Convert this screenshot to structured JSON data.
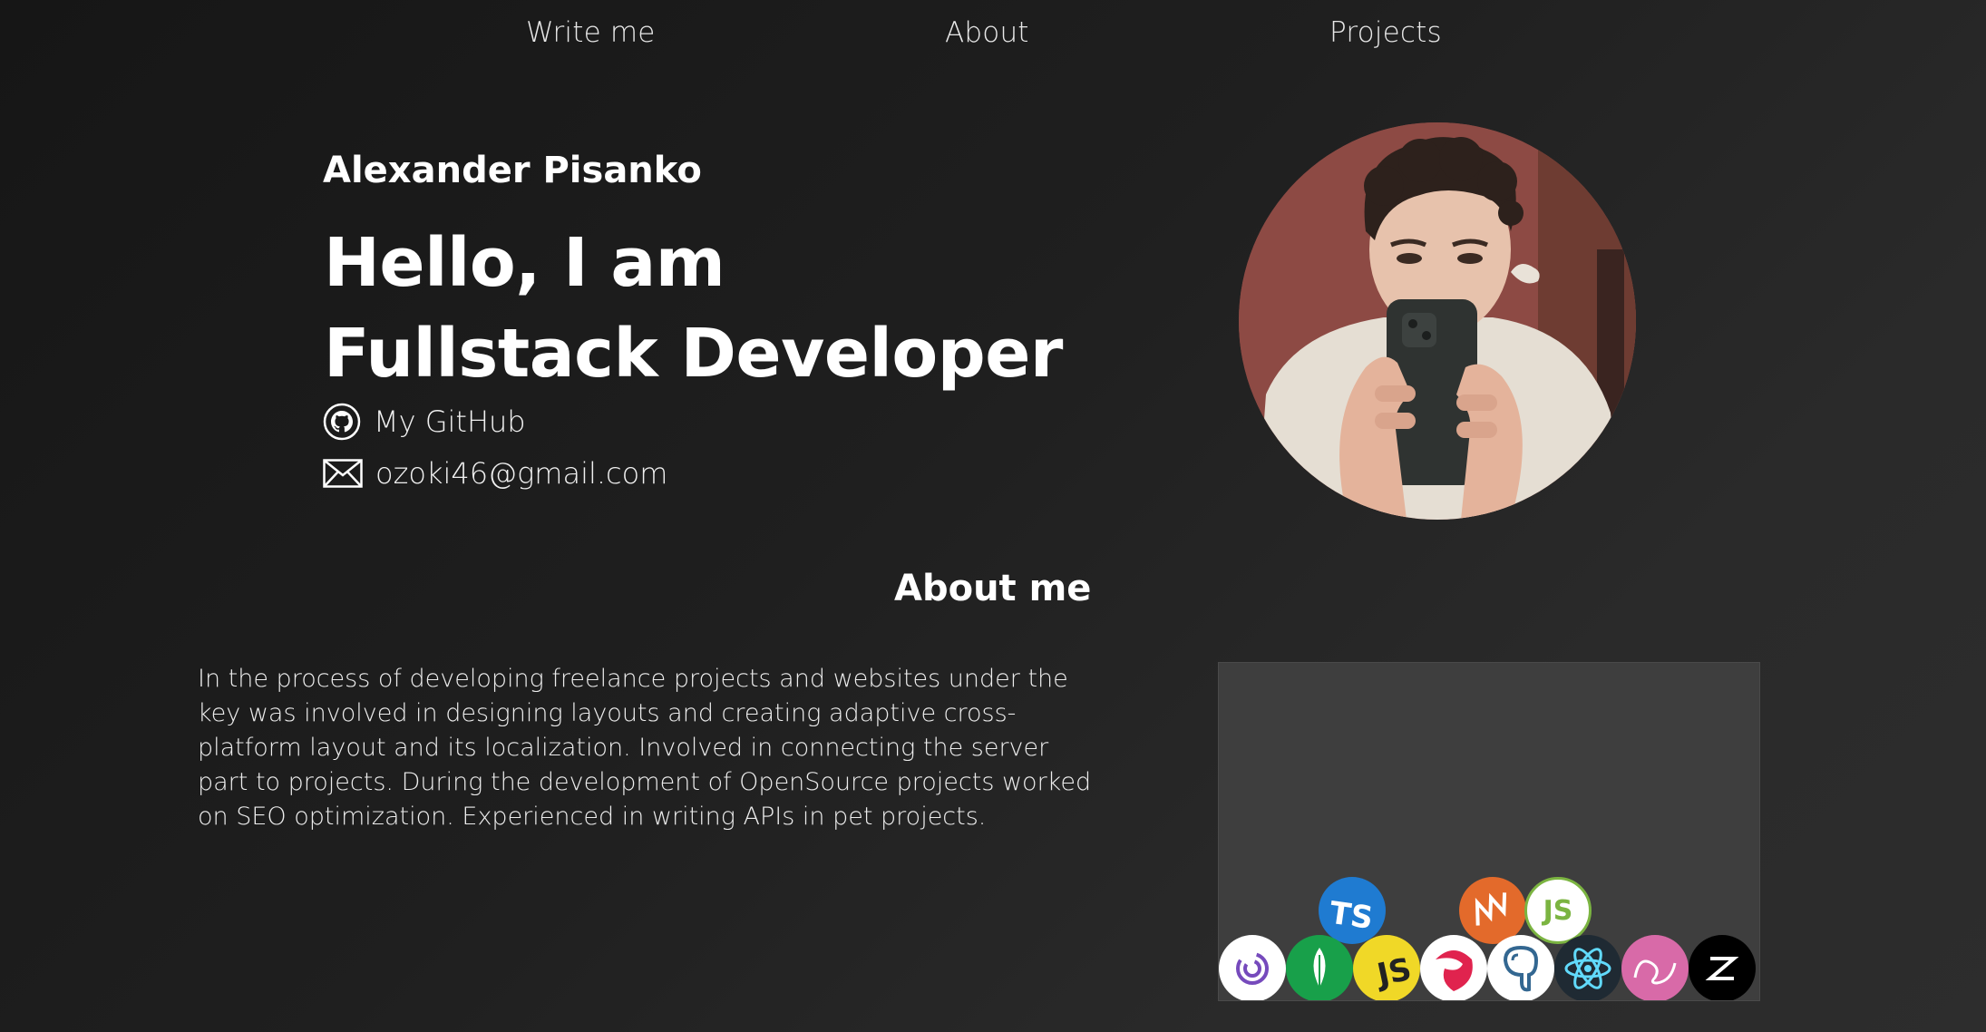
{
  "nav": {
    "write_me": "Write me",
    "about": "About",
    "projects": "Projects"
  },
  "hero": {
    "name": "Alexander Pisanko",
    "title_line1": "Hello, I am",
    "title_line2": "Fullstack Developer",
    "github_label": "My GitHub",
    "email": "ozoki46@gmail.com",
    "github_icon": "github-icon",
    "mail_icon": "mail-icon"
  },
  "about": {
    "heading": "About me",
    "text": "In the process of developing freelance projects and websites under the key was involved in designing layouts and creating adaptive cross-platform layout and its localization. Involved in connecting the server part to projects. During the development of OpenSource projects worked on SEO optimization. Experienced in writing APIs in pet projects."
  },
  "tech": {
    "ts_label": "TS",
    "js_label": "JS",
    "nodejs_label": "JS",
    "icons": [
      "typescript-icon",
      "kotlin-icon",
      "nodejs-icon",
      "redux-icon",
      "mongodb-icon",
      "javascript-icon",
      "nestjs-icon",
      "postgresql-icon",
      "react-icon",
      "redis-icon",
      "nextjs-icon"
    ]
  },
  "colors": {
    "background": "#1f1f1f",
    "text": "#ffffff",
    "tech_box": "#3e3e3e"
  }
}
